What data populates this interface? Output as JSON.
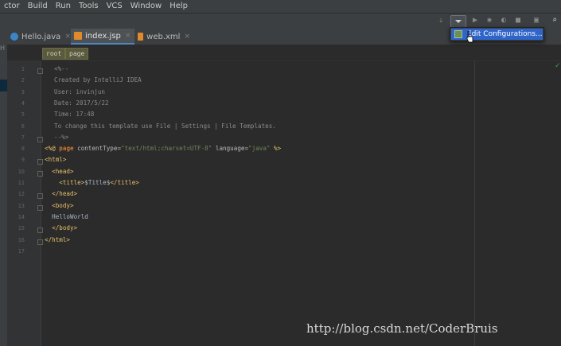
{
  "menu": {
    "items": [
      "ctor",
      "Build",
      "Run",
      "Tools",
      "VCS",
      "Window",
      "Help"
    ]
  },
  "toolbar": {
    "run_config_dropdown": "▾",
    "icons": [
      "run-icon",
      "debug-icon",
      "coverage-icon",
      "profile-icon",
      "stop-icon",
      "project-structure-icon",
      "search-icon"
    ]
  },
  "popup": {
    "item_label": "Edit Configurations..."
  },
  "tabs": [
    {
      "label": "Hello.java",
      "icon": "java-class-icon",
      "color": "#3a86c8"
    },
    {
      "label": "index.jsp",
      "icon": "jsp-file-icon",
      "color": "#e08a2c"
    },
    {
      "label": "web.xml",
      "icon": "xml-file-icon",
      "color": "#e08a2c"
    }
  ],
  "left_strip": {
    "label": "H"
  },
  "breadcrumb": [
    "root",
    "page"
  ],
  "editor": {
    "line_numbers": [
      "1",
      "2",
      "3",
      "4",
      "5",
      "6",
      "7",
      "8",
      "9",
      "10",
      "11",
      "12",
      "13",
      "14",
      "15",
      "16",
      "17"
    ],
    "lines": [
      [
        {
          "t": "<%--",
          "c": "com"
        }
      ],
      [
        {
          "t": "Created by IntelliJ IDEA",
          "c": "com"
        }
      ],
      [
        {
          "t": "User: invinjun",
          "c": "com"
        }
      ],
      [
        {
          "t": "Date: 2017/5/22",
          "c": "com"
        }
      ],
      [
        {
          "t": "Time: 17:48",
          "c": "com"
        }
      ],
      [
        {
          "t": "To change this template use File | Settings | File Templates.",
          "c": "com"
        }
      ],
      [
        {
          "t": "--%>",
          "c": "com"
        }
      ],
      [
        {
          "t": "<%@ ",
          "c": "tag"
        },
        {
          "t": "page ",
          "c": "dir"
        },
        {
          "t": "contentType=",
          "c": "attr"
        },
        {
          "t": "\"text/html;charset=UTF-8\"",
          "c": "str"
        },
        {
          "t": " language=",
          "c": "attr"
        },
        {
          "t": "\"java\"",
          "c": "str"
        },
        {
          "t": " %>",
          "c": "tag"
        }
      ],
      [
        {
          "t": "<html>",
          "c": "tag"
        }
      ],
      [
        {
          "t": "  <head>",
          "c": "tag"
        }
      ],
      [
        {
          "t": "    <title>",
          "c": "tag"
        },
        {
          "t": "$Title$",
          "c": "txt"
        },
        {
          "t": "</title>",
          "c": "tag"
        }
      ],
      [
        {
          "t": "  </head>",
          "c": "tag"
        }
      ],
      [
        {
          "t": "  <body>",
          "c": "tag"
        }
      ],
      [
        {
          "t": "  HelloWorld",
          "c": "txt"
        }
      ],
      [
        {
          "t": "  </body>",
          "c": "tag"
        }
      ],
      [
        {
          "t": "</html>",
          "c": "tag"
        }
      ],
      []
    ]
  },
  "watermark": "http://blog.csdn.net/CoderBruis",
  "colors": {
    "background": "#2b2b2b",
    "selection": "#2f65ca",
    "tag": "#e8bf6a",
    "string": "#6a8759",
    "comment": "#8a8a8a"
  }
}
